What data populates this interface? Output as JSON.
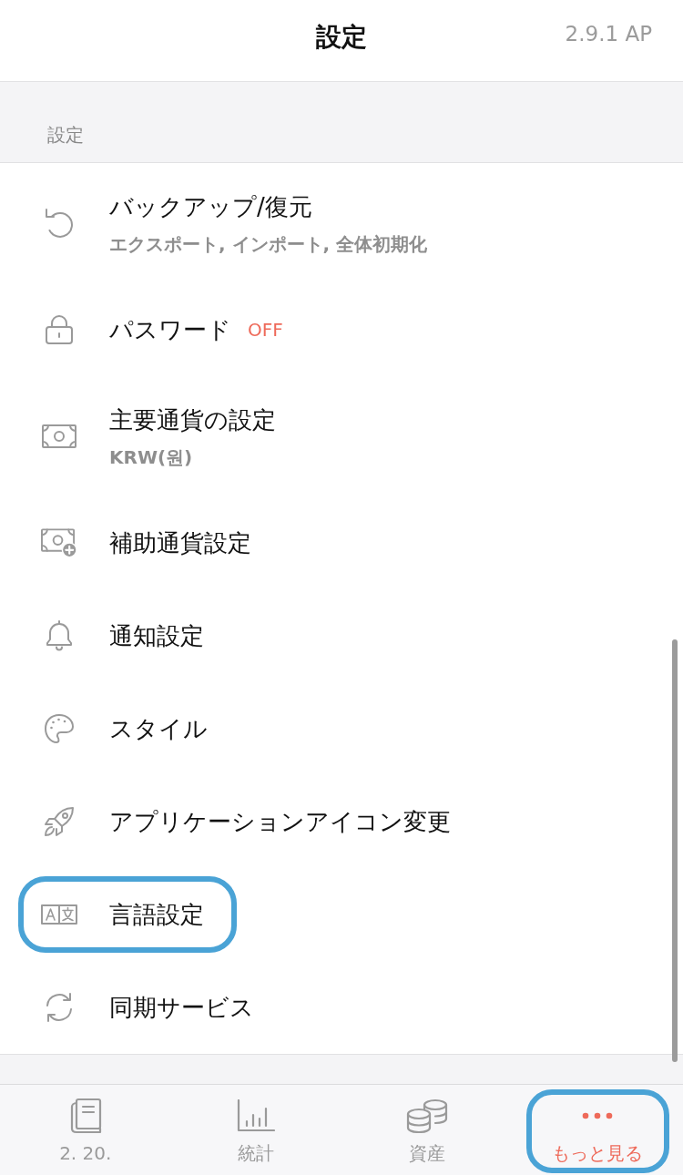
{
  "header": {
    "title": "設定",
    "version": "2.9.1 AP"
  },
  "section": {
    "label": "設定"
  },
  "items": [
    {
      "title": "バックアップ/復元",
      "subtitle": "エクスポート, インポート, 全体初期化",
      "highlighted": false
    },
    {
      "title": "パスワード",
      "status": "OFF",
      "highlighted": false
    },
    {
      "title": "主要通貨の設定",
      "subtitle": "KRW(원)",
      "highlighted": false
    },
    {
      "title": "補助通貨設定",
      "highlighted": false
    },
    {
      "title": "通知設定",
      "highlighted": false
    },
    {
      "title": "スタイル",
      "highlighted": false
    },
    {
      "title": "アプリケーションアイコン変更",
      "highlighted": false
    },
    {
      "title": "言語設定",
      "highlighted": true
    },
    {
      "title": "同期サービス",
      "highlighted": false
    }
  ],
  "tabs": [
    {
      "label": "2. 20.",
      "selected": false,
      "highlighted": false
    },
    {
      "label": "統計",
      "selected": false,
      "highlighted": false
    },
    {
      "label": "資産",
      "selected": false,
      "highlighted": false
    },
    {
      "label": "もっと見る",
      "selected": true,
      "highlighted": true
    }
  ]
}
